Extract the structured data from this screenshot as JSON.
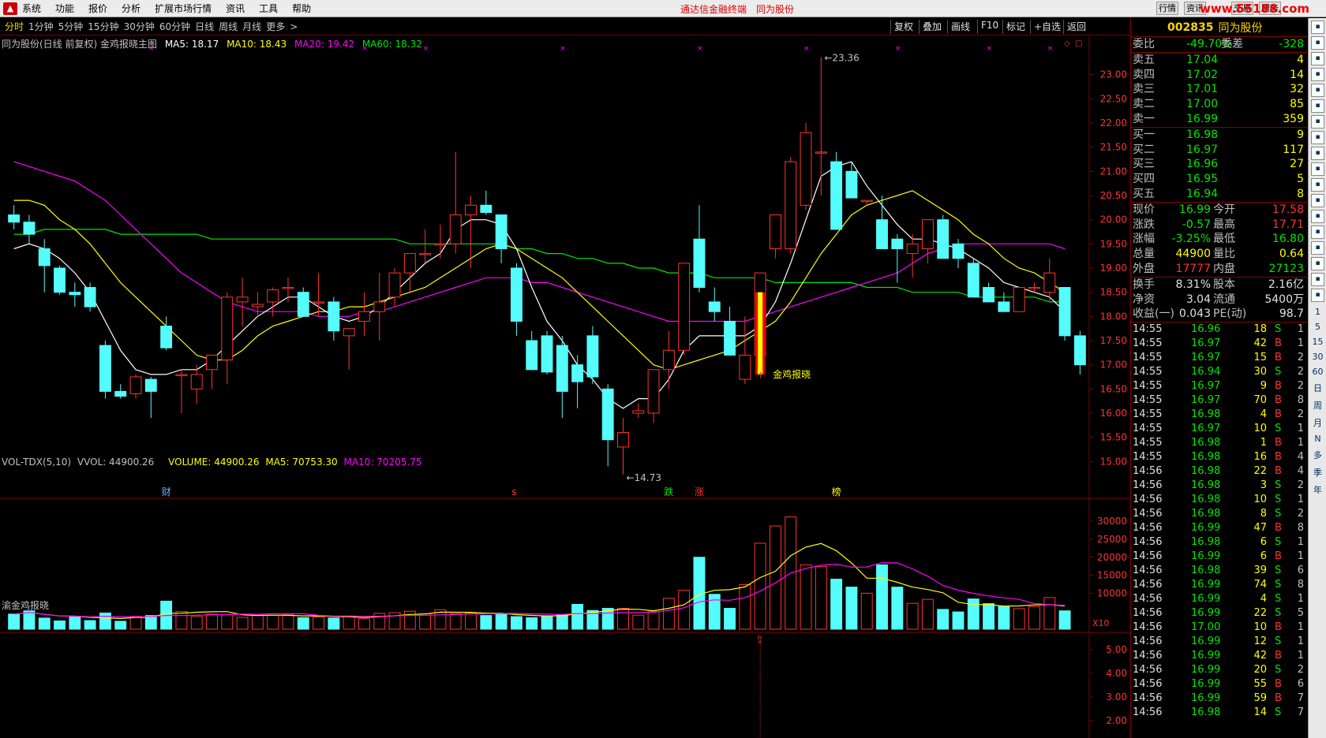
{
  "menu": {
    "items": [
      "系统",
      "功能",
      "报价",
      "分析",
      "扩展市场行情",
      "资讯",
      "工具",
      "帮助"
    ],
    "promo1": "通达信金融终端",
    "promo2": "同为股份",
    "rbtns": [
      "行情",
      "资讯",
      "交易",
      "服务"
    ],
    "watermark": "www.55188.com"
  },
  "tabs": [
    "分时",
    "1分钟",
    "5分钟",
    "15分钟",
    "30分钟",
    "60分钟",
    "日线",
    "周线",
    "月线",
    "更多"
  ],
  "tabs_more": ">",
  "toolbar_right": [
    "复权",
    "叠加",
    "画线",
    "F10",
    "标记",
    "+自选",
    "返回"
  ],
  "main_info": {
    "title": "同为股份(日线 前复权) 金鸡报晓主图",
    "ma5": "MA5: 18.17",
    "ma10": "MA10: 18.43",
    "ma20": "MA20: 19.42",
    "ma60": "MA60: 18.32"
  },
  "vol_info": {
    "title": "VOL-TDX(5,10)",
    "vvol": "VVOL: 44900.26",
    "volume": "VOLUME: 44900.26",
    "ma5": "MA5: 70753.30",
    "ma10": "MA10: 70205.75"
  },
  "ind_info": {
    "title": "渝金鸡报晓"
  },
  "annotations": {
    "high": "23.36",
    "low": "14.73",
    "signal": "金鸡报晓",
    "marker_cai": "财",
    "marker_die": "跌",
    "marker_zhang": "涨",
    "marker_bang": "榜",
    "marker_s": "s",
    "x10": "X10"
  },
  "price_axis": [
    "23.00",
    "22.50",
    "22.00",
    "21.50",
    "21.00",
    "20.50",
    "20.00",
    "19.50",
    "19.00",
    "18.50",
    "18.00",
    "17.50",
    "17.00",
    "16.50",
    "16.00",
    "15.50",
    "15.00"
  ],
  "vol_axis": [
    "30000",
    "25000",
    "20000",
    "15000",
    "10000"
  ],
  "ind_axis": [
    "5.00",
    "4.00",
    "3.00",
    "2.00"
  ],
  "chart_data": {
    "type": "candlestick",
    "ohlc": [
      [
        20.1,
        20.3,
        19.8,
        19.95
      ],
      [
        19.95,
        20.1,
        19.5,
        19.7
      ],
      [
        19.4,
        19.6,
        18.5,
        19.05
      ],
      [
        19.0,
        19.05,
        18.45,
        18.5
      ],
      [
        18.5,
        18.7,
        18.2,
        18.45
      ],
      [
        18.6,
        18.7,
        18.1,
        18.2
      ],
      [
        17.4,
        17.5,
        16.3,
        16.45
      ],
      [
        16.45,
        16.6,
        16.3,
        16.35
      ],
      [
        16.4,
        16.8,
        16.3,
        16.75
      ],
      [
        16.7,
        16.75,
        15.9,
        16.45
      ],
      [
        17.8,
        18.0,
        17.3,
        17.35
      ],
      [
        16.8,
        16.9,
        16.0,
        16.8
      ],
      [
        16.5,
        17.0,
        16.2,
        16.8
      ],
      [
        16.9,
        17.2,
        16.5,
        17.2
      ],
      [
        17.1,
        18.5,
        16.6,
        18.4
      ],
      [
        18.3,
        18.8,
        17.8,
        18.4
      ],
      [
        18.2,
        18.5,
        18.0,
        18.25
      ],
      [
        18.3,
        18.6,
        18.0,
        18.55
      ],
      [
        18.6,
        18.8,
        18.3,
        18.6
      ],
      [
        18.5,
        18.6,
        18.0,
        18.0
      ],
      [
        18.3,
        18.9,
        18.0,
        18.3
      ],
      [
        18.3,
        18.4,
        17.5,
        17.7
      ],
      [
        17.6,
        17.7,
        16.9,
        17.75
      ],
      [
        17.9,
        18.5,
        17.6,
        18.1
      ],
      [
        18.1,
        18.9,
        17.5,
        18.3
      ],
      [
        18.4,
        19.0,
        18.2,
        18.9
      ],
      [
        18.9,
        19.3,
        18.5,
        19.3
      ],
      [
        19.3,
        19.8,
        19.1,
        19.3
      ],
      [
        19.5,
        19.9,
        19.2,
        19.5
      ],
      [
        19.5,
        21.4,
        19.3,
        20.1
      ],
      [
        20.1,
        20.5,
        19.0,
        20.3
      ],
      [
        20.3,
        20.6,
        20.1,
        20.15
      ],
      [
        20.1,
        20.1,
        19.1,
        19.4
      ],
      [
        19.0,
        19.1,
        17.6,
        17.9
      ],
      [
        17.5,
        17.7,
        16.9,
        16.9
      ],
      [
        17.6,
        17.7,
        16.8,
        16.85
      ],
      [
        17.4,
        17.6,
        15.9,
        16.45
      ],
      [
        17.0,
        17.2,
        16.1,
        16.65
      ],
      [
        17.6,
        17.8,
        16.6,
        16.75
      ],
      [
        16.5,
        16.6,
        14.9,
        15.45
      ],
      [
        15.3,
        15.9,
        14.73,
        15.6
      ],
      [
        16.0,
        16.2,
        15.9,
        16.05
      ],
      [
        16.0,
        16.6,
        15.8,
        16.9
      ],
      [
        16.9,
        17.7,
        16.5,
        17.3
      ],
      [
        17.3,
        18.9,
        17.2,
        19.1
      ],
      [
        19.6,
        20.3,
        18.5,
        18.6
      ],
      [
        18.3,
        18.6,
        17.9,
        18.1
      ],
      [
        17.9,
        18.2,
        17.2,
        17.2
      ],
      [
        16.7,
        18.0,
        16.6,
        17.2
      ],
      [
        17.2,
        17.3,
        16.8,
        18.9
      ],
      [
        19.4,
        19.4,
        19.2,
        20.1
      ],
      [
        19.4,
        21.3,
        19.3,
        21.2
      ],
      [
        20.3,
        22.0,
        20.2,
        21.8
      ],
      [
        21.4,
        23.36,
        20.5,
        21.4
      ],
      [
        21.2,
        21.4,
        19.8,
        19.8
      ],
      [
        21.0,
        21.2,
        20.5,
        20.45
      ],
      [
        20.4,
        20.4,
        20.3,
        20.4
      ],
      [
        20.0,
        20.5,
        19.4,
        19.4
      ],
      [
        19.6,
        19.7,
        18.7,
        19.4
      ],
      [
        19.3,
        19.7,
        18.8,
        19.5
      ],
      [
        19.4,
        20.0,
        19.1,
        20.0
      ],
      [
        20.0,
        20.1,
        19.3,
        19.2
      ],
      [
        19.5,
        19.6,
        19.0,
        19.2
      ],
      [
        19.1,
        19.2,
        18.4,
        18.4
      ],
      [
        18.6,
        18.7,
        18.3,
        18.3
      ],
      [
        18.3,
        18.5,
        18.1,
        18.1
      ],
      [
        18.1,
        18.6,
        18.1,
        18.6
      ],
      [
        18.6,
        18.7,
        18.5,
        18.6
      ],
      [
        18.5,
        19.2,
        18.3,
        18.9
      ],
      [
        18.6,
        18.6,
        17.5,
        17.6
      ],
      [
        17.6,
        17.7,
        16.8,
        17.0
      ]
    ],
    "volume": [
      4200,
      5100,
      3100,
      2300,
      3500,
      2400,
      4500,
      2200,
      3600,
      3800,
      7800,
      4900,
      3500,
      4200,
      4000,
      3300,
      4100,
      3900,
      4000,
      3200,
      3400,
      3100,
      3600,
      2900,
      4400,
      4600,
      5000,
      4300,
      5400,
      4300,
      4500,
      3800,
      4200,
      3500,
      3200,
      3700,
      4100,
      6900,
      5200,
      5800,
      5800,
      3900,
      4900,
      8600,
      10800,
      20000,
      9700,
      5800,
      12400,
      23900,
      28700,
      31200,
      17900,
      17400,
      13900,
      11700,
      10000,
      17900,
      11700,
      7200,
      8300,
      5500,
      4800,
      8400,
      7100,
      6300,
      5700,
      6300,
      8800,
      5100
    ],
    "ma5": [
      19.4,
      19.5,
      19.4,
      19.2,
      18.9,
      18.5,
      17.9,
      17.3,
      16.9,
      16.8,
      16.8,
      16.9,
      16.9,
      17.1,
      17.4,
      17.7,
      18.0,
      18.2,
      18.4,
      18.4,
      18.2,
      18.0,
      17.9,
      18.0,
      18.2,
      18.5,
      18.8,
      19.1,
      19.3,
      19.8,
      20.0,
      20.0,
      19.9,
      19.4,
      18.6,
      17.9,
      17.5,
      17.0,
      16.7,
      16.3,
      16.1,
      16.3,
      16.3,
      16.7,
      17.3,
      17.6,
      17.6,
      17.6,
      17.6,
      17.8,
      18.3,
      19.1,
      20.0,
      20.9,
      21.1,
      21.2,
      20.7,
      20.3,
      19.9,
      19.6,
      19.6,
      19.5,
      19.4,
      19.2,
      19.0,
      18.7,
      18.6,
      18.5,
      18.4,
      18.1
    ],
    "ma10": [
      20.4,
      20.4,
      20.3,
      20.0,
      19.8,
      19.5,
      19.1,
      18.7,
      18.4,
      18.1,
      17.8,
      17.5,
      17.2,
      17.1,
      17.1,
      17.3,
      17.6,
      17.8,
      17.9,
      18.0,
      18.1,
      18.1,
      18.2,
      18.2,
      18.3,
      18.4,
      18.5,
      18.6,
      18.8,
      19.0,
      19.2,
      19.4,
      19.5,
      19.4,
      19.2,
      19.0,
      18.8,
      18.5,
      18.2,
      17.9,
      17.6,
      17.3,
      17.0,
      16.9,
      17.0,
      17.1,
      17.2,
      17.3,
      17.5,
      17.7,
      17.9,
      18.3,
      18.8,
      19.3,
      19.7,
      20.1,
      20.3,
      20.4,
      20.5,
      20.6,
      20.4,
      20.2,
      20.0,
      19.7,
      19.5,
      19.2,
      19.0,
      18.9,
      18.7,
      18.5
    ],
    "ma20": [
      21.2,
      21.1,
      21.0,
      20.9,
      20.8,
      20.6,
      20.4,
      20.1,
      19.8,
      19.5,
      19.2,
      18.9,
      18.7,
      18.5,
      18.3,
      18.2,
      18.1,
      18.1,
      18.1,
      18.1,
      18.0,
      18.0,
      18.0,
      18.1,
      18.1,
      18.2,
      18.3,
      18.4,
      18.5,
      18.6,
      18.7,
      18.8,
      18.8,
      18.8,
      18.7,
      18.7,
      18.6,
      18.5,
      18.4,
      18.3,
      18.2,
      18.1,
      18.0,
      17.9,
      17.9,
      17.9,
      17.9,
      17.9,
      17.9,
      18.0,
      18.1,
      18.2,
      18.3,
      18.4,
      18.5,
      18.6,
      18.7,
      18.8,
      18.9,
      19.1,
      19.3,
      19.4,
      19.5,
      19.5,
      19.5,
      19.5,
      19.5,
      19.5,
      19.5,
      19.4
    ],
    "ma60": [
      19.7,
      19.7,
      19.8,
      19.8,
      19.8,
      19.8,
      19.8,
      19.7,
      19.7,
      19.7,
      19.7,
      19.7,
      19.7,
      19.6,
      19.6,
      19.6,
      19.6,
      19.6,
      19.6,
      19.6,
      19.6,
      19.6,
      19.6,
      19.6,
      19.6,
      19.6,
      19.5,
      19.5,
      19.5,
      19.5,
      19.5,
      19.5,
      19.5,
      19.4,
      19.4,
      19.3,
      19.3,
      19.2,
      19.2,
      19.1,
      19.1,
      19.0,
      19.0,
      18.9,
      18.9,
      18.9,
      18.8,
      18.8,
      18.8,
      18.8,
      18.7,
      18.7,
      18.7,
      18.7,
      18.7,
      18.7,
      18.6,
      18.6,
      18.6,
      18.5,
      18.5,
      18.5,
      18.5,
      18.4,
      18.4,
      18.4,
      18.4,
      18.4,
      18.3,
      18.3
    ],
    "ylim": [
      14.5,
      23.5
    ],
    "signal_index": 49
  },
  "panel": {
    "code": "002835",
    "name": "同为股份",
    "weibi": {
      "l1": "委比",
      "v1": "-49.70%",
      "l2": "委差",
      "v2": "-328"
    },
    "sells": [
      {
        "l": "卖五",
        "p": "17.04",
        "q": "4"
      },
      {
        "l": "卖四",
        "p": "17.02",
        "q": "14"
      },
      {
        "l": "卖三",
        "p": "17.01",
        "q": "32"
      },
      {
        "l": "卖二",
        "p": "17.00",
        "q": "85"
      },
      {
        "l": "卖一",
        "p": "16.99",
        "q": "359"
      }
    ],
    "buys": [
      {
        "l": "买一",
        "p": "16.98",
        "q": "9"
      },
      {
        "l": "买二",
        "p": "16.97",
        "q": "117"
      },
      {
        "l": "买三",
        "p": "16.96",
        "q": "27"
      },
      {
        "l": "买四",
        "p": "16.95",
        "q": "5"
      },
      {
        "l": "买五",
        "p": "16.94",
        "q": "8"
      }
    ],
    "stats": [
      {
        "l1": "现价",
        "v1": "16.99",
        "l2": "今开",
        "v2": "17.58"
      },
      {
        "l1": "涨跌",
        "v1": "-0.57",
        "l2": "最高",
        "v2": "17.71"
      },
      {
        "l1": "涨幅",
        "v1": "-3.25%",
        "l2": "最低",
        "v2": "16.80"
      },
      {
        "l1": "总量",
        "v1": "44900",
        "l2": "量比",
        "v2": "0.64"
      },
      {
        "l1": "外盘",
        "v1": "17777",
        "l2": "内盘",
        "v2": "27123"
      }
    ],
    "stats2": [
      {
        "l1": "换手",
        "v1": "8.31%",
        "l2": "股本",
        "v2": "2.16亿"
      },
      {
        "l1": "净资",
        "v1": "3.04",
        "l2": "流通",
        "v2": "5400万"
      },
      {
        "l1": "收益(一)",
        "v1": "0.043",
        "l2": "PE(动)",
        "v2": "98.7"
      }
    ],
    "ticks": [
      [
        "14:55",
        "16.96",
        "18",
        "S",
        "1"
      ],
      [
        "14:55",
        "16.97",
        "42",
        "B",
        "1"
      ],
      [
        "14:55",
        "16.97",
        "15",
        "B",
        "2"
      ],
      [
        "14:55",
        "16.94",
        "30",
        "S",
        "2"
      ],
      [
        "14:55",
        "16.97",
        "9",
        "B",
        "2"
      ],
      [
        "14:55",
        "16.97",
        "70",
        "B",
        "8"
      ],
      [
        "14:55",
        "16.98",
        "4",
        "B",
        "2"
      ],
      [
        "14:55",
        "16.97",
        "10",
        "S",
        "1"
      ],
      [
        "14:55",
        "16.98",
        "1",
        "B",
        "1"
      ],
      [
        "14:55",
        "16.98",
        "16",
        "B",
        "4"
      ],
      [
        "14:56",
        "16.98",
        "22",
        "B",
        "4"
      ],
      [
        "14:56",
        "16.98",
        "3",
        "S",
        "2"
      ],
      [
        "14:56",
        "16.98",
        "10",
        "S",
        "1"
      ],
      [
        "14:56",
        "16.98",
        "8",
        "S",
        "2"
      ],
      [
        "14:56",
        "16.99",
        "47",
        "B",
        "8"
      ],
      [
        "14:56",
        "16.98",
        "6",
        "S",
        "1"
      ],
      [
        "14:56",
        "16.99",
        "6",
        "B",
        "1"
      ],
      [
        "14:56",
        "16.98",
        "39",
        "S",
        "6"
      ],
      [
        "14:56",
        "16.99",
        "74",
        "S",
        "8"
      ],
      [
        "14:56",
        "16.99",
        "4",
        "S",
        "1"
      ],
      [
        "14:56",
        "16.99",
        "22",
        "S",
        "5"
      ],
      [
        "14:56",
        "17.00",
        "10",
        "B",
        "1"
      ],
      [
        "14:56",
        "16.99",
        "12",
        "S",
        "1"
      ],
      [
        "14:56",
        "16.99",
        "42",
        "B",
        "1"
      ],
      [
        "14:56",
        "16.99",
        "20",
        "S",
        "2"
      ],
      [
        "14:56",
        "16.99",
        "55",
        "B",
        "6"
      ],
      [
        "14:56",
        "16.99",
        "59",
        "B",
        "7"
      ],
      [
        "14:56",
        "16.98",
        "14",
        "S",
        "7"
      ]
    ]
  },
  "righttool": [
    "1",
    "5",
    "15",
    "30",
    "60",
    "日",
    "周",
    "月",
    "N",
    "多",
    "季",
    "年"
  ],
  "colors": {
    "up": "#ff3232",
    "down": "#54fcfc",
    "ma5": "#ffffff",
    "ma10": "#ffff00",
    "ma20": "#ff00ff",
    "ma60": "#00e600",
    "frame": "#800000",
    "signal": "#ffff00"
  }
}
